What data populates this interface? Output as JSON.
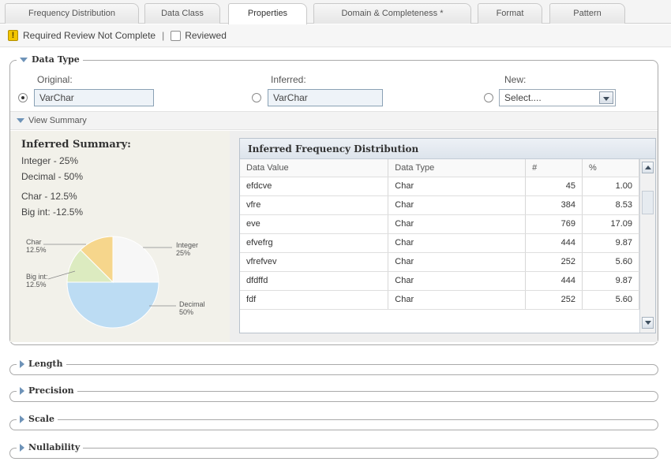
{
  "tabs": [
    {
      "label": "Frequency Distribution",
      "active": false
    },
    {
      "label": "Data Class",
      "active": false
    },
    {
      "label": "Properties",
      "active": true
    },
    {
      "label": "Domain & Completeness *",
      "active": false
    },
    {
      "label": "Format",
      "active": false
    },
    {
      "label": "Pattern",
      "active": false
    }
  ],
  "review": {
    "warning_text": "Required Review Not Complete",
    "separator": "|",
    "reviewed_label": "Reviewed",
    "reviewed_checked": false,
    "warning_icon": "warning-icon",
    "warning_glyph": "!"
  },
  "data_type": {
    "legend": "Data Type",
    "original_label": "Original:",
    "original_value": "VarChar",
    "inferred_label": "Inferred:",
    "inferred_value": "VarChar",
    "new_label": "New:",
    "new_value": "Select....",
    "selected": "original"
  },
  "view_summary": {
    "label": "View Summary"
  },
  "inferred_summary": {
    "title": "Inferred Summary:",
    "lines": [
      "Integer - 25%",
      "Decimal - 50%",
      "Char - 12.5%",
      "Big int: -12.5%"
    ]
  },
  "pie": {
    "labels": [
      {
        "name": "Char",
        "pct": "12.5%"
      },
      {
        "name": "Big int:",
        "pct": "12.5%"
      },
      {
        "name": "Integer",
        "pct": "25%"
      },
      {
        "name": "Decimal",
        "pct": "50%"
      }
    ],
    "colors": {
      "integer": "#f7f7f7",
      "decimal": "#bcdcf3",
      "bigint": "#dcebc0",
      "char": "#f6d68c"
    }
  },
  "freq_table": {
    "title": "Inferred Frequency Distribution",
    "columns": [
      "Data Value",
      "Data Type",
      "#",
      "%"
    ],
    "rows": [
      [
        "efdcve",
        "Char",
        "45",
        "1.00"
      ],
      [
        "vfre",
        "Char",
        "384",
        "8.53"
      ],
      [
        "eve",
        "Char",
        "769",
        "17.09"
      ],
      [
        "efvefrg",
        "Char",
        "444",
        "9.87"
      ],
      [
        "vfrefvev",
        "Char",
        "252",
        "5.60"
      ],
      [
        "dfdffd",
        "Char",
        "444",
        "9.87"
      ],
      [
        "fdf",
        "Char",
        "252",
        "5.60"
      ]
    ]
  },
  "sections": [
    {
      "label": "Length"
    },
    {
      "label": "Precision"
    },
    {
      "label": "Scale"
    },
    {
      "label": "Nullability"
    }
  ]
}
